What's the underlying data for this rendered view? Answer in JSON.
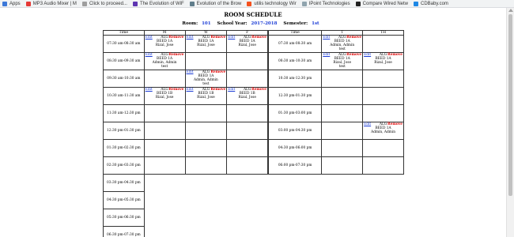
{
  "bookmarks": [
    {
      "label": "Apps",
      "color": "#3c78d8"
    },
    {
      "label": "MP3 Audio Mixer | M",
      "color": "#e53935"
    },
    {
      "label": "Click to proceed...",
      "color": "#9e9e9e"
    },
    {
      "label": "The Evolution of WiF",
      "color": "#5e35b1"
    },
    {
      "label": "Evolution of the Brow",
      "color": "#607d8b"
    },
    {
      "label": "utilis technology Wir",
      "color": "#f4511e"
    },
    {
      "label": "IPoint Technologies",
      "color": "#90a4ae"
    },
    {
      "label": "Compare Wired Netw",
      "color": "#212121"
    },
    {
      "label": "CDBaby.com",
      "color": "#1e88e5"
    }
  ],
  "header": {
    "title": "ROOM SCHEDULE",
    "room_label": "Room:",
    "room": "101",
    "year_label": "School Year:",
    "year": "2017-2018",
    "sem_label": "Semester:",
    "sem": "1st"
  },
  "tables": [
    {
      "headers": [
        "Time",
        "M",
        "W",
        "F"
      ],
      "rows": [
        {
          "time": "07:30 am-08:30 am",
          "cells": [
            {
              "subj": "ALG",
              "lines": [
                "BEED 1A",
                "Rizal, Jose"
              ]
            },
            {
              "subj": "ALG",
              "lines": [
                "BEED 1A",
                "Rizal, Jose"
              ]
            },
            {
              "subj": "ALG",
              "lines": [
                "BEED 1A",
                "Rizal, Jose"
              ]
            }
          ]
        },
        {
          "time": "08:30 am-09:30 am",
          "cells": [
            {
              "subj": "ALG",
              "lines": [
                "BEED 1A",
                "Admin, Admin",
                "test"
              ]
            },
            null,
            null
          ]
        },
        {
          "time": "09:30 am-10:30 am",
          "cells": [
            null,
            {
              "subj": "ALG",
              "lines": [
                "BEED 1A",
                "Admin, Admin",
                "test"
              ]
            },
            null
          ]
        },
        {
          "time": "10:30 am-11:30 am",
          "cells": [
            {
              "subj": "ALG",
              "lines": [
                "BEED 1B",
                "Rizal, Jose"
              ]
            },
            {
              "subj": "ALG",
              "lines": [
                "BEED 1B",
                "Rizal, Jose"
              ]
            },
            {
              "subj": "ALG",
              "lines": [
                "BEED 1B",
                "Rizal, Jose"
              ]
            }
          ]
        },
        {
          "time": "11:30 am-12:30 pm",
          "cells": [
            null,
            null,
            null
          ]
        },
        {
          "time": "12:30 pm-01:30 pm",
          "cells": [
            null,
            null,
            null
          ]
        },
        {
          "time": "01:30 pm-02:30 pm",
          "cells": [
            null,
            null,
            null
          ]
        },
        {
          "time": "02:30 pm-03:30 pm",
          "cells": [
            null,
            null,
            null
          ]
        },
        {
          "time": "03:30 pm-04:30 pm",
          "cells": []
        },
        {
          "time": "04:30 pm-05:30 pm",
          "cells": []
        },
        {
          "time": "05:30 pm-06:30 pm",
          "cells": []
        },
        {
          "time": "06:30 pm-07:30 pm",
          "cells": []
        }
      ]
    },
    {
      "headers": [
        "Time",
        "T",
        "TH"
      ],
      "rows": [
        {
          "time": "07:30 am-08:30 am",
          "cells": [
            {
              "subj": "ALG",
              "lines": [
                "BEED 1A",
                "Admin, Admin",
                "test"
              ]
            },
            null
          ]
        },
        {
          "time": "08:30 am-10:30 am",
          "cells": [
            {
              "subj": "ALG",
              "lines": [
                "BEED 1A",
                "Rizal, Jose",
                "test"
              ]
            },
            {
              "subj": "ALG",
              "lines": [
                "BEED 1A",
                "Rizal, Jose"
              ]
            }
          ]
        },
        {
          "time": "10:30 am-12:30 pm",
          "cells": [
            null,
            null
          ]
        },
        {
          "time": "12:30 pm-01:30 pm",
          "cells": [
            null,
            null
          ]
        },
        {
          "time": "01:30 pm-03:00 pm",
          "cells": [
            null,
            null
          ]
        },
        {
          "time": "03:00 pm-04:30 pm",
          "cells": [
            null,
            {
              "subj": "ALG",
              "lines": [
                "BEED 1A",
                "Admin, Admin"
              ]
            }
          ]
        },
        {
          "time": "04:30 pm-06:00 pm",
          "cells": [
            null,
            null
          ]
        },
        {
          "time": "06:00 pm-07:30 pm",
          "cells": [
            null,
            null
          ]
        }
      ]
    }
  ],
  "labels": {
    "edit": "Edit",
    "remove": "Remove"
  }
}
